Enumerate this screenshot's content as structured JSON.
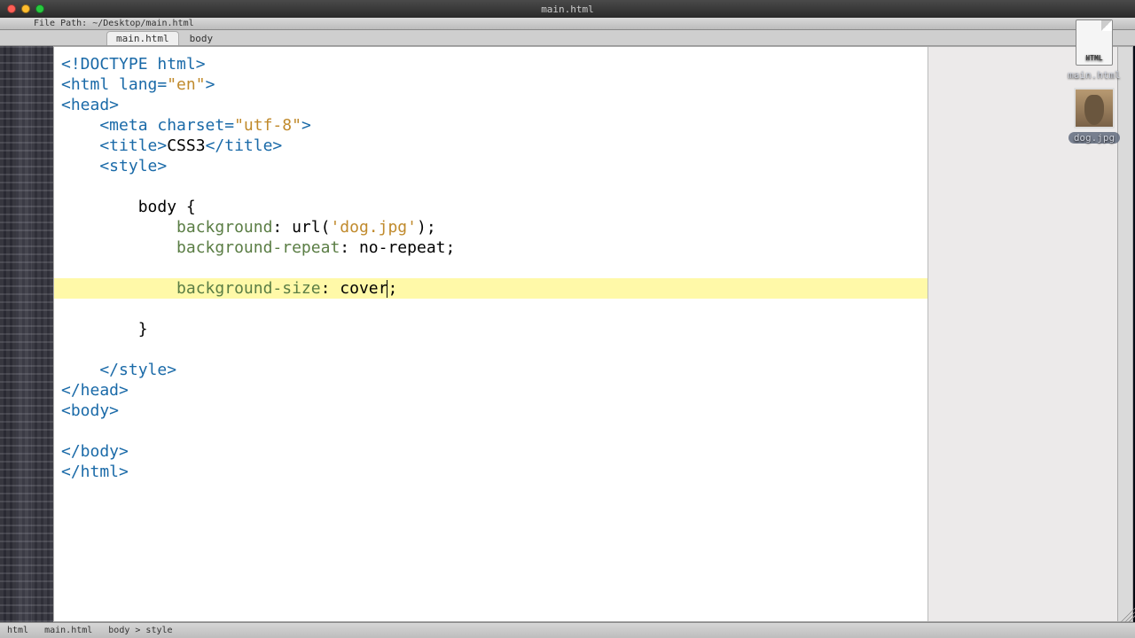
{
  "os": {
    "title": "main.html"
  },
  "toolbar": {
    "path": "File Path: ~/Desktop/main.html"
  },
  "tabs": {
    "file": "main.html",
    "breadcrumb": "body"
  },
  "desktop_icons": {
    "html": {
      "badge": "HTML",
      "label": "main.html"
    },
    "image": {
      "label": "dog.jpg"
    }
  },
  "statusbar": {
    "left": "html",
    "mid": "main.html",
    "right": "body > style"
  },
  "code": {
    "l1": "<!DOCTYPE html>",
    "l2a": "<html ",
    "l2b": "lang=",
    "l2c": "\"en\"",
    "l2d": ">",
    "l3": "<head>",
    "l4a": "    <meta ",
    "l4b": "charset=",
    "l4c": "\"utf-8\"",
    "l4d": ">",
    "l5a": "    <title>",
    "l5b": "CSS3",
    "l5c": "</title>",
    "l6": "    <style>",
    "blank": "",
    "l8": "        body {",
    "l9a": "            ",
    "l9b": "background",
    "l9c": ": url(",
    "l9d": "'dog.jpg'",
    "l9e": ");",
    "l10a": "            ",
    "l10b": "background-repeat",
    "l10c": ": no-repeat;",
    "l12a": "            ",
    "l12b": "background-size",
    "l12c": ": cover",
    "l12d": ";",
    "l13": "        }",
    "l15": "    </style>",
    "l16": "</head>",
    "l17": "<body>",
    "l19": "</body>",
    "l20": "</html>"
  }
}
